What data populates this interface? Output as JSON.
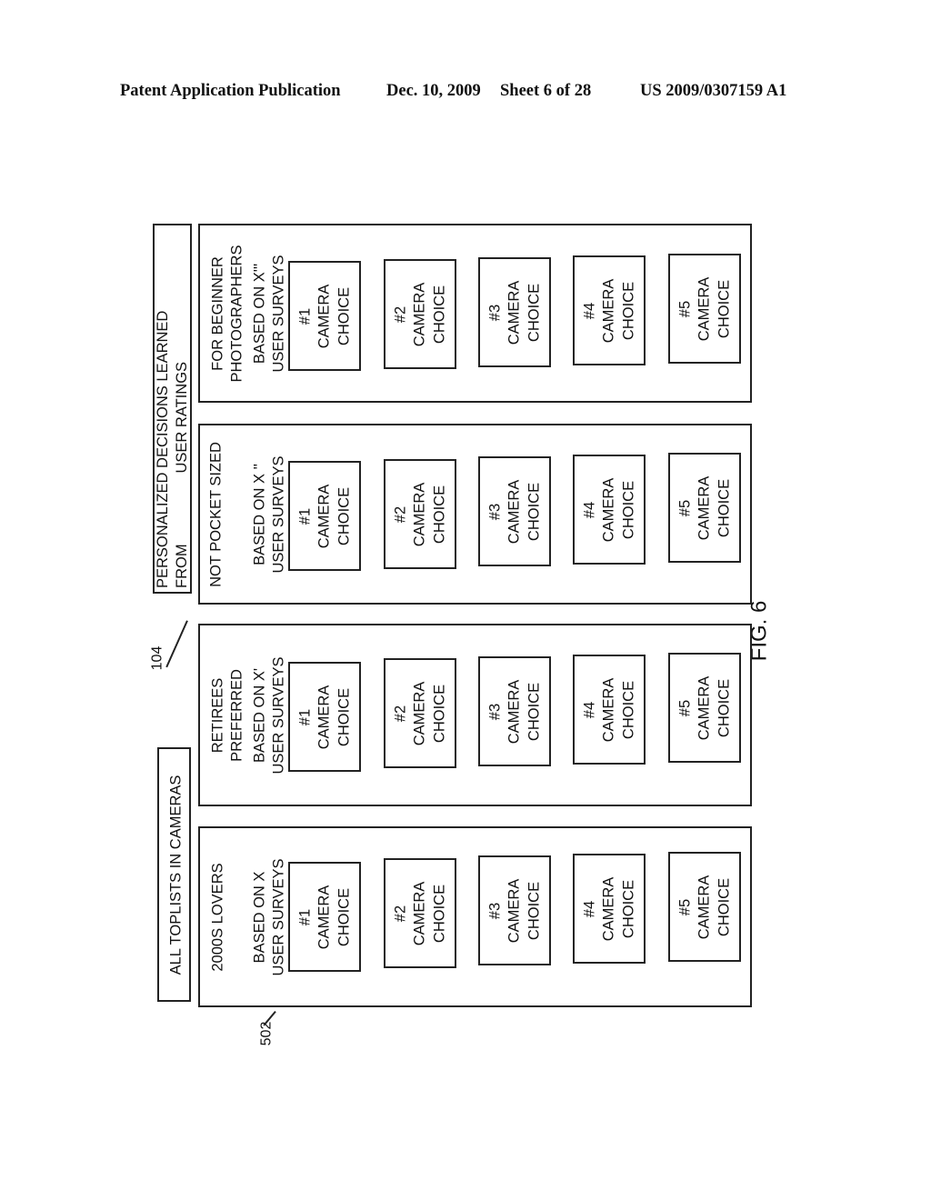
{
  "header": {
    "publication": "Patent Application Publication",
    "date": "Dec. 10, 2009",
    "sheet": "Sheet 6 of 28",
    "number": "US 2009/0307159 A1"
  },
  "figure_label": "FIG. 6",
  "tabs": {
    "all_toplists": "ALL TOPLISTS IN CAMERAS",
    "personalized": {
      "line1": "PERSONALIZED DECISIONS LEARNED",
      "line2": "FROM                 USER RATINGS"
    }
  },
  "references": {
    "tab_ref": "104",
    "panel_ref": "502"
  },
  "panels": [
    {
      "title_lines": [
        "2000S LOVERS"
      ],
      "basis_lines": [
        "BASED ON X",
        "USER SURVEYS"
      ],
      "choices": [
        {
          "rank": "#1",
          "line2": "CAMERA",
          "line3": "CHOICE"
        },
        {
          "rank": "#2",
          "line2": "CAMERA",
          "line3": "CHOICE"
        },
        {
          "rank": "#3",
          "line2": "CAMERA",
          "line3": "CHOICE"
        },
        {
          "rank": "#4",
          "line2": "CAMERA",
          "line3": "CHOICE"
        },
        {
          "rank": "#5",
          "line2": "CAMERA",
          "line3": "CHOICE"
        }
      ]
    },
    {
      "title_lines": [
        "RETIREES",
        "PREFERRED"
      ],
      "basis_lines": [
        "BASED ON X'",
        "USER SURVEYS"
      ],
      "choices": [
        {
          "rank": "#1",
          "line2": "CAMERA",
          "line3": "CHOICE"
        },
        {
          "rank": "#2",
          "line2": "CAMERA",
          "line3": "CHOICE"
        },
        {
          "rank": "#3",
          "line2": "CAMERA",
          "line3": "CHOICE"
        },
        {
          "rank": "#4",
          "line2": "CAMERA",
          "line3": "CHOICE"
        },
        {
          "rank": "#5",
          "line2": "CAMERA",
          "line3": "CHOICE"
        }
      ]
    },
    {
      "title_lines": [
        "NOT POCKET SIZED"
      ],
      "basis_lines": [
        "BASED ON X ''",
        "USER SURVEYS"
      ],
      "choices": [
        {
          "rank": "#1",
          "line2": "CAMERA",
          "line3": "CHOICE"
        },
        {
          "rank": "#2",
          "line2": "CAMERA",
          "line3": "CHOICE"
        },
        {
          "rank": "#3",
          "line2": "CAMERA",
          "line3": "CHOICE"
        },
        {
          "rank": "#4",
          "line2": "CAMERA",
          "line3": "CHOICE"
        },
        {
          "rank": "#5",
          "line2": "CAMERA",
          "line3": "CHOICE"
        }
      ]
    },
    {
      "title_lines": [
        "FOR BEGINNER",
        "PHOTOGRAPHERS"
      ],
      "basis_lines": [
        "BASED ON X'''",
        "USER SURVEYS"
      ],
      "choices": [
        {
          "rank": "#1",
          "line2": "CAMERA",
          "line3": "CHOICE"
        },
        {
          "rank": "#2",
          "line2": "CAMERA",
          "line3": "CHOICE"
        },
        {
          "rank": "#3",
          "line2": "CAMERA",
          "line3": "CHOICE"
        },
        {
          "rank": "#4",
          "line2": "CAMERA",
          "line3": "CHOICE"
        },
        {
          "rank": "#5",
          "line2": "CAMERA",
          "line3": "CHOICE"
        }
      ]
    }
  ]
}
